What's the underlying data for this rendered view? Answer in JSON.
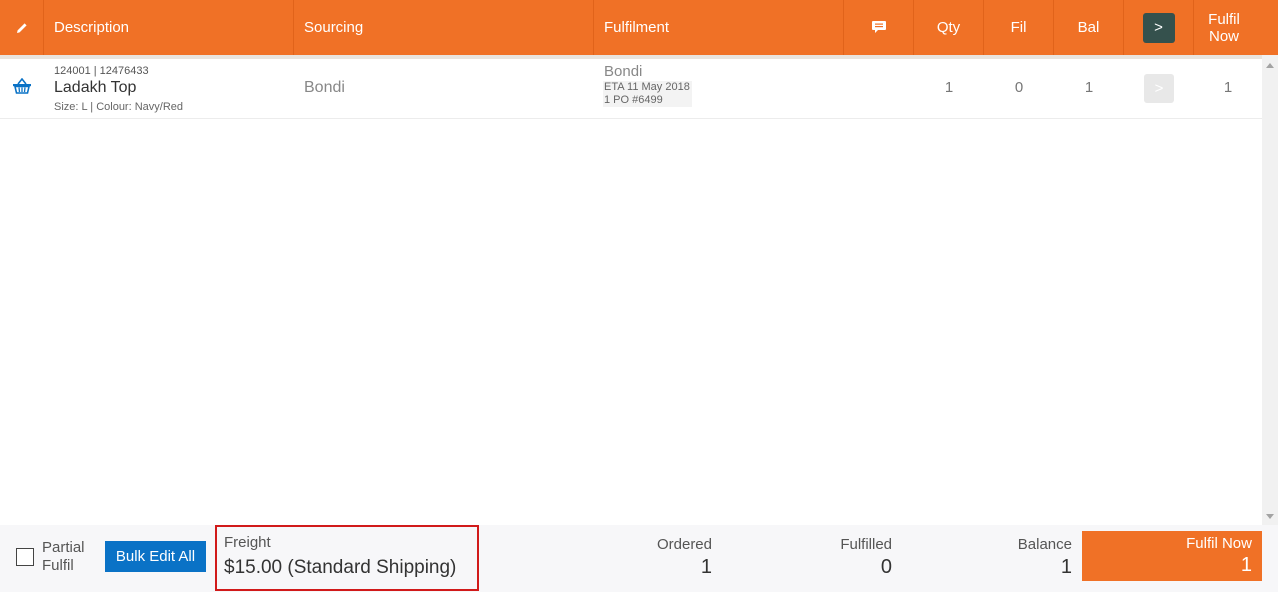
{
  "header": {
    "edit_icon": "pencil-icon",
    "description": "Description",
    "sourcing": "Sourcing",
    "fulfilment": "Fulfilment",
    "notes_icon": "chat-bubble-icon",
    "qty": "Qty",
    "fil": "Fil",
    "bal": "Bal",
    "nav_button": ">",
    "fulfil_now_line1": "Fulfil",
    "fulfil_now_line2": "Now"
  },
  "rows": [
    {
      "icon": "basket-icon",
      "ids": "124001 | 12476433",
      "name": "Ladakh Top",
      "attributes": "Size: L | Colour: Navy/Red",
      "sourcing": "Bondi",
      "fulfilment_location": "Bondi",
      "eta": "ETA 11 May 2018",
      "po": "1 PO #6499",
      "qty": "1",
      "fil": "0",
      "bal": "1",
      "nav_button": ">",
      "fulfil_now": "1"
    }
  ],
  "footer": {
    "partial_line1": "Partial",
    "partial_line2": "Fulfil",
    "bulk_edit": "Bulk Edit All",
    "freight_label": "Freight",
    "freight_value": "$15.00 (Standard Shipping)",
    "ordered_label": "Ordered",
    "ordered_value": "1",
    "fulfilled_label": "Fulfilled",
    "fulfilled_value": "0",
    "balance_label": "Balance",
    "balance_value": "1",
    "fulfil_now_label": "Fulfil Now",
    "fulfil_now_value": "1"
  },
  "colors": {
    "accent": "#f07126",
    "nav_button": "#35514d",
    "bulk_button": "#0a72c6",
    "highlight_border": "#d11a1a"
  }
}
